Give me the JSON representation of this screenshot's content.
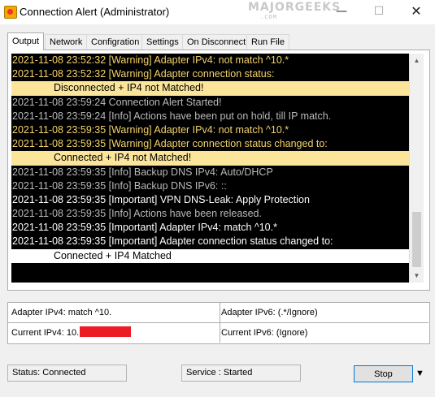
{
  "window": {
    "title": "Connection Alert (Administrator)",
    "watermark": "MAJORGEEKS",
    "watermark_sub": ".COM",
    "controls": {
      "minimize": "—",
      "maximize": "☐",
      "close": "✕"
    }
  },
  "tabs": [
    {
      "label": "Output",
      "active": true
    },
    {
      "label": "Network"
    },
    {
      "label": "Configration"
    },
    {
      "label": "Settings"
    },
    {
      "label": "On Disconnect"
    },
    {
      "label": "Run File"
    }
  ],
  "log": [
    {
      "text": "2021-11-08 23:52:32 [Warning] Adapter IPv4: not match ^10.*",
      "level": "warning"
    },
    {
      "text": "2021-11-08 23:52:32 [Warning] Adapter connection status:",
      "level": "warning"
    },
    {
      "text": "Disconnected + IP4 not Matched!",
      "level": "status-warn"
    },
    {
      "text": "2021-11-08 23:59:24 Connection Alert Started!",
      "level": "info"
    },
    {
      "text": "2021-11-08 23:59:24 [Info] Actions have been put on hold, till IP match.",
      "level": "info"
    },
    {
      "text": "2021-11-08 23:59:35 [Warning] Adapter IPv4: not match ^10.*",
      "level": "warning"
    },
    {
      "text": "2021-11-08 23:59:35 [Warning] Adapter connection status changed to:",
      "level": "warning"
    },
    {
      "text": "Connected + IP4 not Matched!",
      "level": "status-warn"
    },
    {
      "text": "2021-11-08 23:59:35 [Info] Backup DNS IPv4: Auto/DHCP",
      "level": "info"
    },
    {
      "text": "2021-11-08 23:59:35 [Info] Backup DNS IPv6: ::",
      "level": "info"
    },
    {
      "text": "2021-11-08 23:59:35 [Important] VPN DNS-Leak: Apply Protection",
      "level": "important"
    },
    {
      "text": "2021-11-08 23:59:35 [Info] Actions have been released.",
      "level": "info"
    },
    {
      "text": "2021-11-08 23:59:35 [Important] Adapter IPv4: match ^10.*",
      "level": "important"
    },
    {
      "text": "2021-11-08 23:59:35 [Important] Adapter connection status changed to:",
      "level": "important"
    },
    {
      "text": "Connected + IP4 Matched",
      "level": "status-ok"
    }
  ],
  "scrollbar": {
    "up_arrow": "▲",
    "down_arrow": "▼"
  },
  "info": {
    "adapter_ipv4": "Adapter IPv4: match ^10.",
    "adapter_ipv6": "Adapter IPv6: (.*/Ignore)",
    "current_ipv4": "Current IPv4: 10.",
    "current_ipv6": "Current IPv6: (Ignore)"
  },
  "status": {
    "connection": "Status: Connected",
    "service": "Service : Started",
    "stop_label": "Stop",
    "dropdown_arrow": "▼"
  },
  "colors": {
    "warning": "#f4d36b",
    "info": "#b9b9b9",
    "important": "#ffffff",
    "status_warn_bg": "#fae59a",
    "redaction": "#ec1c24"
  }
}
